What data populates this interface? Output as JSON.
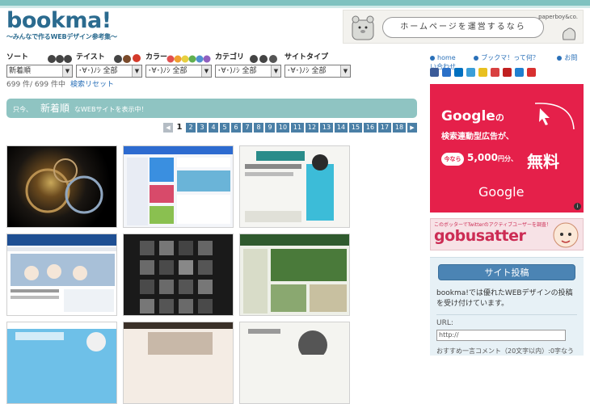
{
  "logo": {
    "main": "bookma!",
    "sub": "～みんなで作るWEBデザイン参考集～"
  },
  "top_banner": {
    "bubble": "ホームページを運営するなら",
    "brand": "paperboy&co."
  },
  "filters": [
    {
      "label": "ソート",
      "value": "新着順"
    },
    {
      "label": "テイスト",
      "value": "･∀･)ﾉｼ 全部"
    },
    {
      "label": "カラー",
      "value": "･∀･)ﾉｼ 全部"
    },
    {
      "label": "カテゴリ",
      "value": "･∀･)ﾉｼ 全部"
    },
    {
      "label": "サイトタイプ",
      "value": "･∀･)ﾉｼ 全部"
    }
  ],
  "count": {
    "text": "699 件/ 699 件中",
    "reset": "検索リセット"
  },
  "notice": {
    "prefix": "只今、",
    "highlight": "新着順",
    "suffix": "なWEBサイトを表示中！"
  },
  "pager": {
    "current": "1",
    "pages": [
      "2",
      "3",
      "4",
      "5",
      "6",
      "7",
      "8",
      "9",
      "10",
      "11",
      "12",
      "13",
      "14",
      "15",
      "16",
      "17",
      "18"
    ],
    "prev": "◀",
    "next": "▶"
  },
  "right_links": [
    "home",
    "ブックマ！って何？",
    "お問い合わせ"
  ],
  "google_ad": {
    "line1": "Google",
    "line1_suffix": "の",
    "line2": "検索連動型広告が、",
    "pill": "今なら",
    "amount": "5,000",
    "amount_unit": "円分、",
    "free": "無料",
    "logo": "Google",
    "info": "i"
  },
  "gobu_banner": {
    "small": "このボッターでTwitterのアクティブユーザーを調査！",
    "big": "gobusatter"
  },
  "submit": {
    "button": "サイト投稿",
    "text": "bookma!では優れたWEBデザインの投稿を受け付けています。",
    "url_label": "URL:",
    "url_value": "http://",
    "comment_label": "おすすめ一言コメント（20文字以内）:0字なう"
  },
  "colors": {
    "brand": "#2b6b8f",
    "accent": "#8fc4c2",
    "link": "#2a70b8",
    "ad": "#e5204a",
    "pager": "#4a7fa6"
  }
}
